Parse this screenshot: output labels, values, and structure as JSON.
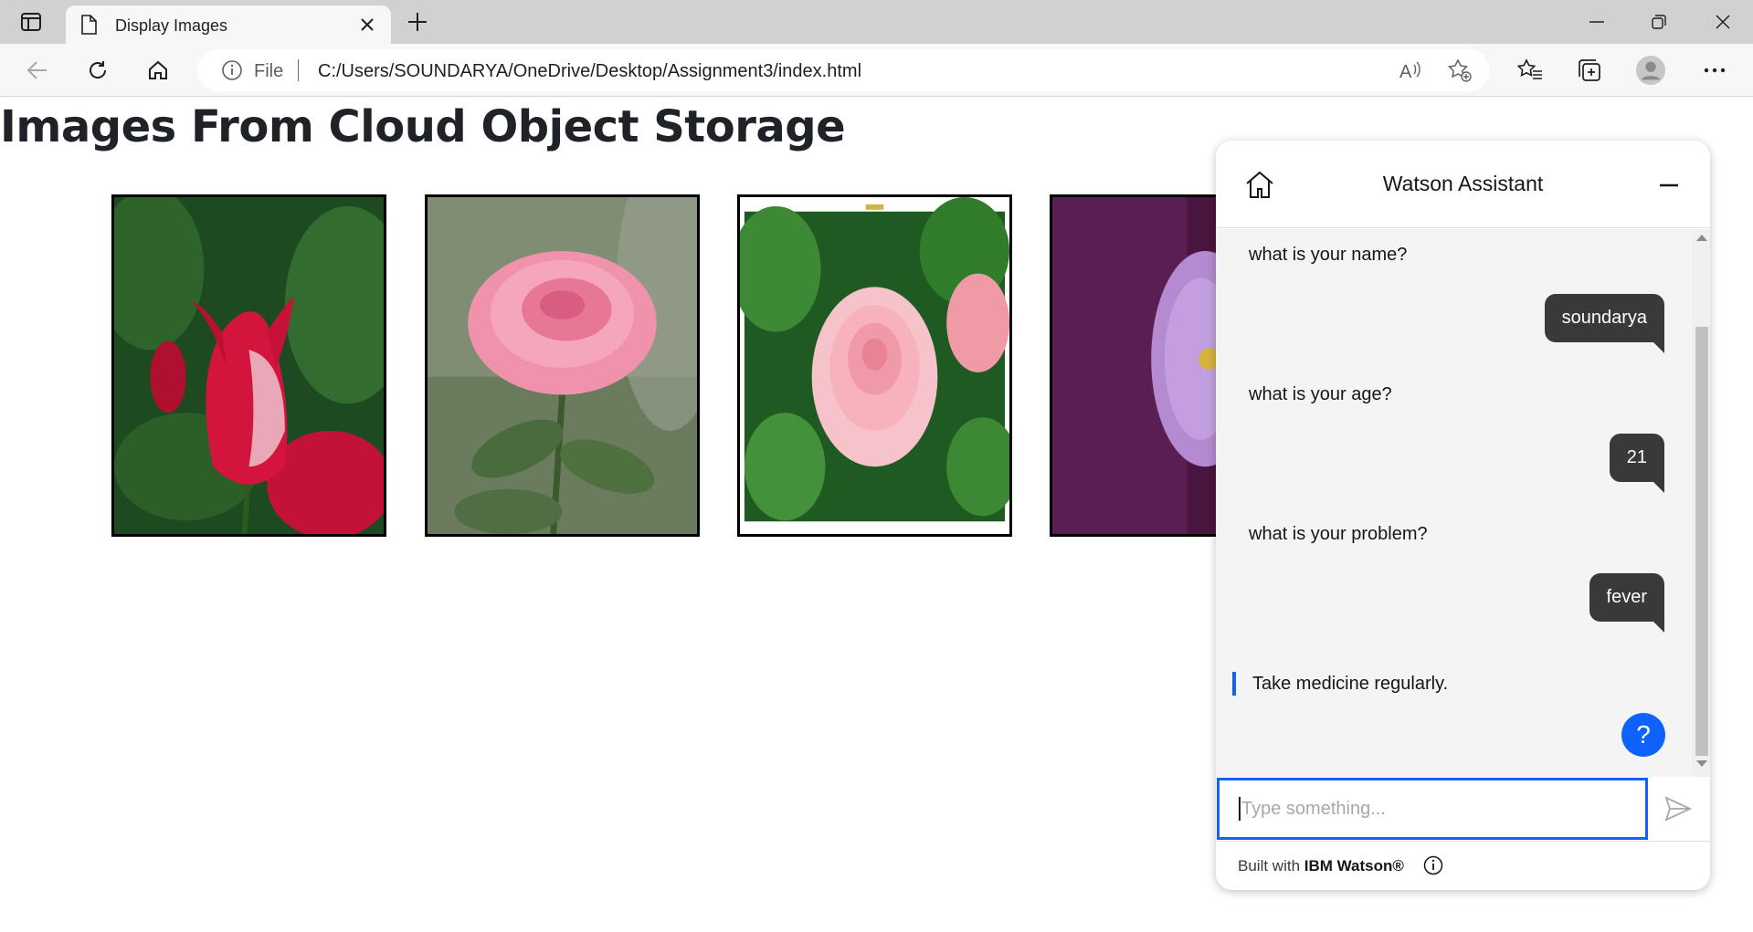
{
  "browser": {
    "tab_title": "Display Images",
    "address_label": "File",
    "url": "C:/Users/SOUNDARYA/OneDrive/Desktop/Assignment3/index.html"
  },
  "page": {
    "heading": "Images From Cloud Object Storage",
    "images": [
      {
        "alt": "red rose"
      },
      {
        "alt": "pink rose"
      },
      {
        "alt": "pink camellia"
      },
      {
        "alt": "purple daisy"
      }
    ]
  },
  "watson": {
    "title": "Watson Assistant",
    "messages": {
      "q1": "what is your name?",
      "a1": "soundarya",
      "q2": "what is your age?",
      "a2": "21",
      "q3": "what is your problem?",
      "a3": "fever",
      "reply": "Take medicine regularly."
    },
    "input_placeholder": "Type something...",
    "help_label": "?",
    "footer_prefix": "Built with ",
    "footer_brand": "IBM Watson®",
    "accent": "#0f62fe"
  }
}
